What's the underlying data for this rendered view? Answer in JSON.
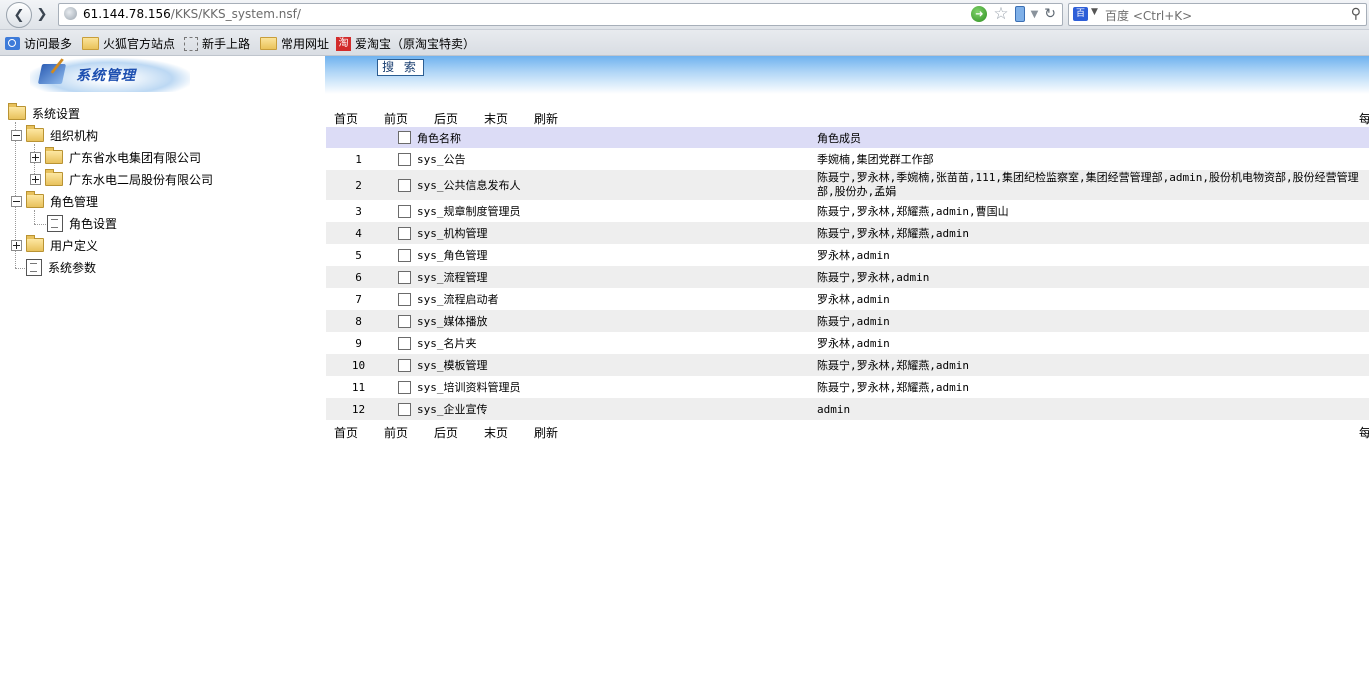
{
  "browser": {
    "url_host": "61.144.78.156",
    "url_path": "/KKS/KKS_system.nsf/",
    "search_placeholder": "百度 <Ctrl+K>",
    "baidu_glyph": "百"
  },
  "bookmarks": [
    {
      "label": "访问最多",
      "icon": "magnifier-icon"
    },
    {
      "label": "火狐官方站点",
      "icon": "folder-icon"
    },
    {
      "label": "新手上路",
      "icon": "dashed-box-icon"
    },
    {
      "label": "常用网址",
      "icon": "folder-icon"
    },
    {
      "label": "爱淘宝（原淘宝特卖）",
      "icon": "taobao-icon",
      "glyph": "淘"
    }
  ],
  "sidebar": {
    "logo_text": "系统管理",
    "tree": {
      "root": "系统设置",
      "org": "组织机构",
      "org_child_1": "广东省水电集团有限公司",
      "org_child_2": "广东水电二局股份有限公司",
      "role_mgmt": "角色管理",
      "role_settings": "角色设置",
      "user_def": "用户定义",
      "sys_params": "系统参数"
    }
  },
  "toolbar": {
    "search_label": "搜 索"
  },
  "pager": {
    "first": "首页",
    "prev": "前页",
    "next": "后页",
    "last": "末页",
    "refresh": "刷新",
    "right_text": "每"
  },
  "table": {
    "headers": {
      "name": "角色名称",
      "members": "角色成员"
    },
    "rows": [
      {
        "num": "1",
        "name": "sys_公告",
        "members": "季婉楠,集团党群工作部"
      },
      {
        "num": "2",
        "name": "sys_公共信息发布人",
        "members": "陈聂宁,罗永林,季婉楠,张苗苗,111,集团纪检监察室,集团经营管理部,admin,股份机电物资部,股份经营管理部,股份办,孟娟"
      },
      {
        "num": "3",
        "name": "sys_规章制度管理员",
        "members": "陈聂宁,罗永林,郑耀燕,admin,曹国山"
      },
      {
        "num": "4",
        "name": "sys_机构管理",
        "members": "陈聂宁,罗永林,郑耀燕,admin"
      },
      {
        "num": "5",
        "name": "sys_角色管理",
        "members": "罗永林,admin"
      },
      {
        "num": "6",
        "name": "sys_流程管理",
        "members": "陈聂宁,罗永林,admin"
      },
      {
        "num": "7",
        "name": "sys_流程启动者",
        "members": "罗永林,admin"
      },
      {
        "num": "8",
        "name": "sys_媒体播放",
        "members": "陈聂宁,admin"
      },
      {
        "num": "9",
        "name": "sys_名片夹",
        "members": "罗永林,admin"
      },
      {
        "num": "10",
        "name": "sys_模板管理",
        "members": "陈聂宁,罗永林,郑耀燕,admin"
      },
      {
        "num": "11",
        "name": "sys_培训资料管理员",
        "members": "陈聂宁,罗永林,郑耀燕,admin"
      },
      {
        "num": "12",
        "name": "sys_企业宣传",
        "members": "admin"
      }
    ]
  }
}
